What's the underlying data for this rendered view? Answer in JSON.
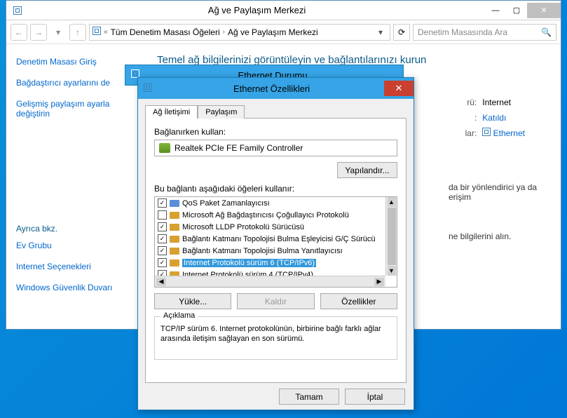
{
  "main": {
    "title": "Ağ ve Paylaşım Merkezi",
    "breadcrumb": {
      "pre": "«",
      "seg1": "Tüm Denetim Masası Öğeleri",
      "seg2": "Ağ ve Paylaşım Merkezi"
    },
    "search_placeholder": "Denetim Masasında Ara",
    "heading": "Temel ağ bilgilerinizi görüntüleyin ve bağlantılarınızı kurun"
  },
  "sidebar": {
    "home": "Denetim Masası Giriş",
    "adapter": "Bağdaştırıcı ayarlarını de",
    "sharing": "Gelişmiş paylaşım ayarla    değiştirin",
    "see_also": "Ayrıca bkz.",
    "links": [
      "Ev Grubu",
      "Internet Seçenekleri",
      "Windows Güvenlik Duvarı"
    ]
  },
  "right": {
    "r1_label": "rü:",
    "r1_val": "Internet",
    "r2_label": ":",
    "r2_val": "Katıldı",
    "r3_label": "lar:",
    "r3_val": "Ethernet"
  },
  "body_lines": {
    "a": "da bir yönlendirici ya da erişim",
    "b": "ne bilgilerini alın."
  },
  "status_title": "Ethernet Durumu",
  "dialog": {
    "title": "Ethernet Özellikleri",
    "tab1": "Ağ İletişimi",
    "tab2": "Paylaşım",
    "connect_using": "Bağlanırken kullan:",
    "adapter": "Realtek PCIe FE Family Controller",
    "configure": "Yapılandır...",
    "items_label": "Bu bağlantı aşağıdaki öğeleri kullanır:",
    "items": [
      {
        "checked": true,
        "icon": "sched",
        "label": "QoS Paket Zamanlayıcısı"
      },
      {
        "checked": false,
        "icon": "proto",
        "label": "Microsoft Ağ Bağdaştırıcısı Çoğullayıcı Protokolü"
      },
      {
        "checked": true,
        "icon": "proto",
        "label": "Microsoft LLDP Protokolü Sürücüsü"
      },
      {
        "checked": true,
        "icon": "proto",
        "label": "Bağlantı Katmanı Topolojisi Bulma Eşleyicisi G/Ç Sürücü"
      },
      {
        "checked": true,
        "icon": "proto",
        "label": "Bağlantı Katmanı Topolojisi Bulma Yanıtlayıcısı"
      },
      {
        "checked": true,
        "icon": "proto",
        "label": "Internet Protokolü sürüm 6 (TCP/IPv6)",
        "selected": true
      },
      {
        "checked": true,
        "icon": "proto",
        "label": "Internet Protokolü sürüm 4 (TCP/IPv4)"
      }
    ],
    "install": "Yükle...",
    "uninstall": "Kaldır",
    "properties": "Özellikler",
    "desc_legend": "Açıklama",
    "desc_text": "TCP/IP sürüm 6. Internet protokolünün, birbirine bağlı farklı ağlar arasında iletişim sağlayan en son sürümü.",
    "ok": "Tamam",
    "cancel": "İptal"
  }
}
